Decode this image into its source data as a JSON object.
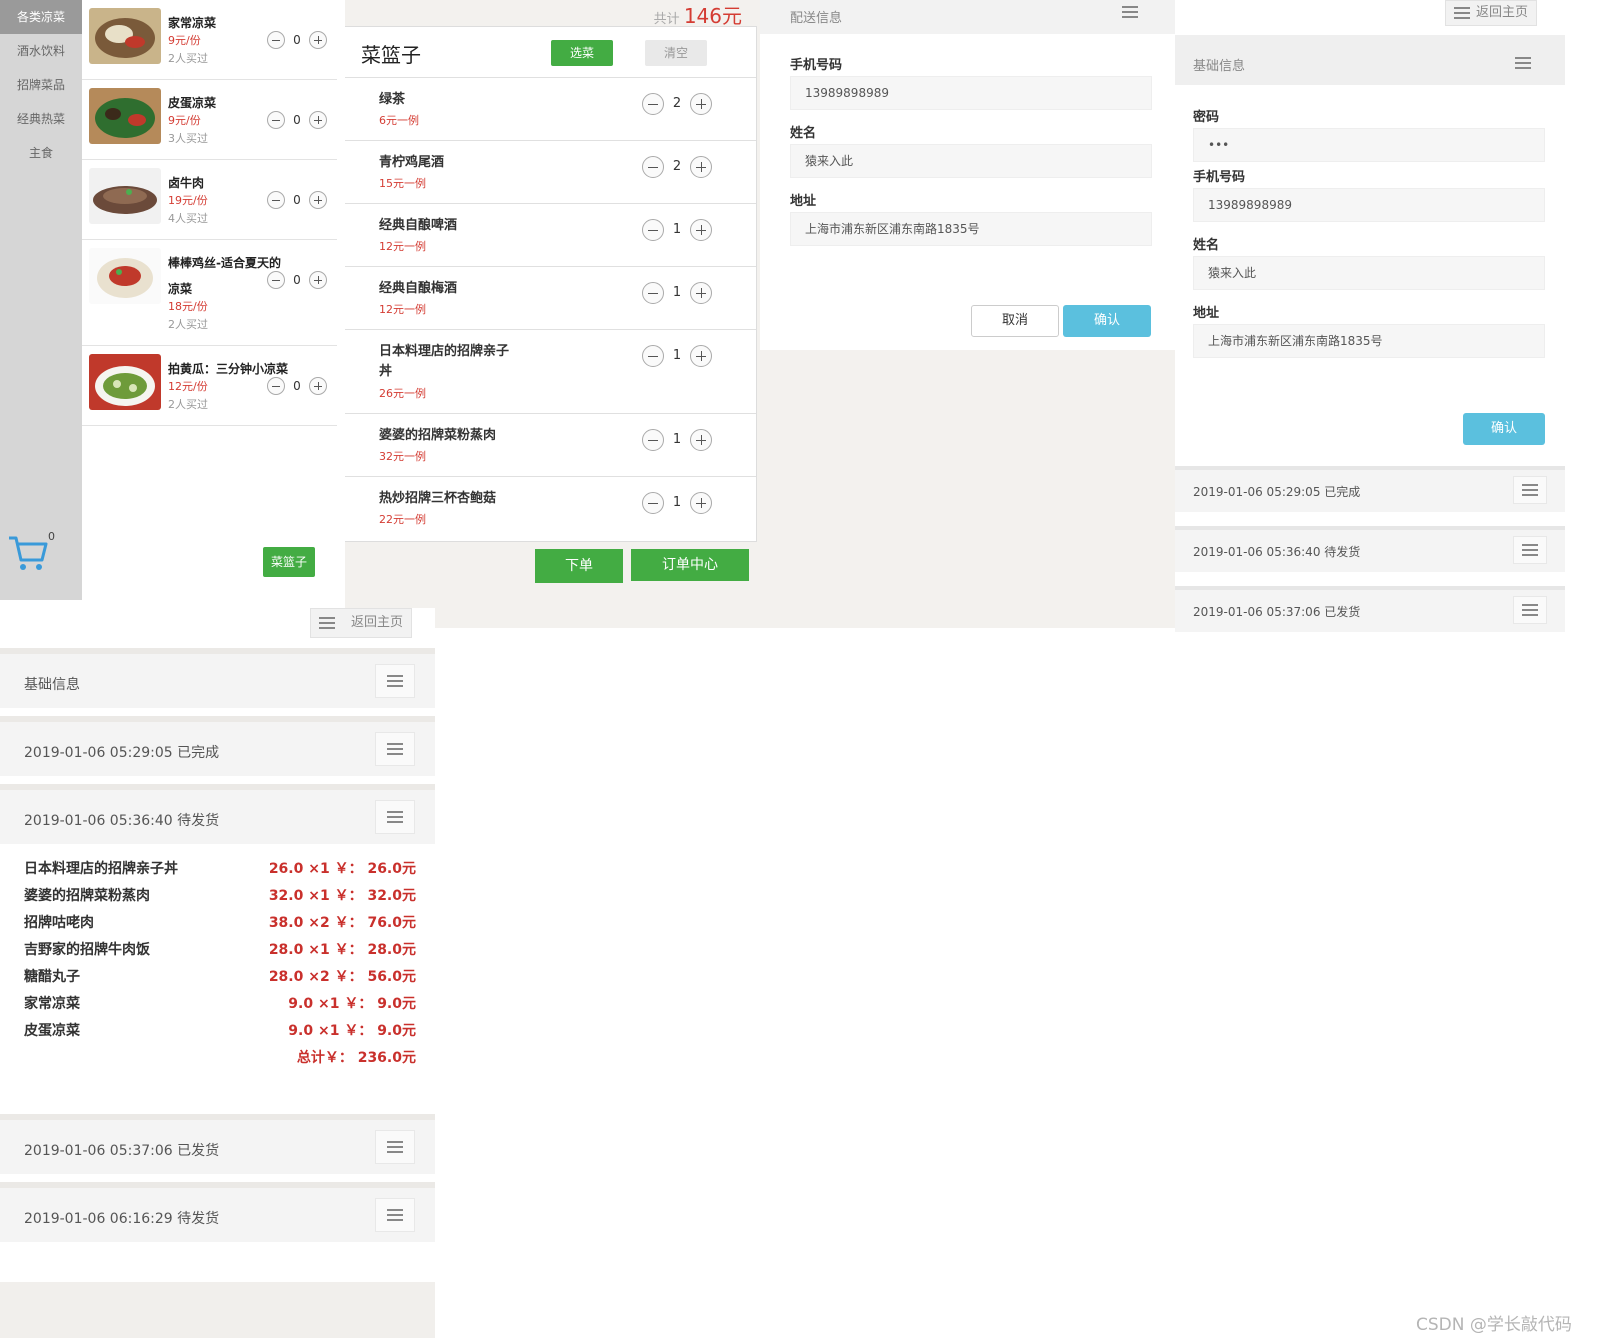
{
  "menu": {
    "categories": [
      "各类凉菜",
      "酒水饮料",
      "招牌菜品",
      "经典热菜",
      "主食"
    ],
    "cart_count": "0",
    "dishes": [
      {
        "name": "家常凉菜",
        "price": "9元/份",
        "sold": "2人买过",
        "qty": "0"
      },
      {
        "name": "皮蛋凉菜",
        "price": "9元/份",
        "sold": "3人买过",
        "qty": "0"
      },
      {
        "name": "卤牛肉",
        "price": "19元/份",
        "sold": "4人买过",
        "qty": "0"
      },
      {
        "name": "棒棒鸡丝-适合夏天的",
        "name2": "凉菜",
        "price": "18元/份",
        "sold": "2人买过",
        "qty": "0"
      },
      {
        "name": "拍黄瓜：三分钟小凉菜",
        "price": "12元/份",
        "sold": "2人买过",
        "qty": "0"
      }
    ],
    "basket_label": "菜篮子"
  },
  "basket": {
    "total_label": "共计",
    "total_value": "146元",
    "title": "菜篮子",
    "pick_label": "选菜",
    "clear_label": "清空",
    "items": [
      {
        "name": "绿茶",
        "price": "6元一例",
        "qty": "2"
      },
      {
        "name": "青柠鸡尾酒",
        "price": "15元一例",
        "qty": "2"
      },
      {
        "name": "经典自酿啤酒",
        "price": "12元一例",
        "qty": "1"
      },
      {
        "name": "经典自酿梅酒",
        "price": "12元一例",
        "qty": "1"
      },
      {
        "name": "日本料理店的招牌亲子丼",
        "price": "26元一例",
        "qty": "1"
      },
      {
        "name": "婆婆的招牌菜粉蒸肉",
        "price": "32元一例",
        "qty": "1"
      },
      {
        "name": "热炒招牌三杯杏鲍菇",
        "price": "22元一例",
        "qty": "1"
      }
    ],
    "order_label": "下单",
    "center_label": "订单中心"
  },
  "delivery": {
    "header": "配送信息",
    "phone_label": "手机号码",
    "phone_value": "13989898989",
    "name_label": "姓名",
    "name_value": "猿来入此",
    "address_label": "地址",
    "address_value": "上海市浦东新区浦东南路1835号",
    "cancel_label": "取消",
    "confirm_label": "确认"
  },
  "account": {
    "back_label": "返回主页",
    "info_header": "基础信息",
    "password_label": "密码",
    "password_value": "•••",
    "phone_label": "手机号码",
    "phone_value": "13989898989",
    "name_label": "姓名",
    "name_value": "猿来入此",
    "address_label": "地址",
    "address_value": "上海市浦东新区浦东南路1835号",
    "confirm_label": "确认",
    "orders": [
      "2019-01-06 05:29:05 已完成",
      "2019-01-06 05:36:40 待发货",
      "2019-01-06 05:37:06 已发货"
    ]
  },
  "orders_panel": {
    "back_label": "返回主页",
    "info_header": "基础信息",
    "order1": "2019-01-06 05:29:05 已完成",
    "order2": "2019-01-06 05:36:40 待发货",
    "details": [
      {
        "name": "日本料理店的招牌亲子丼",
        "calc": "26.0 ×1 ￥： 26.0元"
      },
      {
        "name": "婆婆的招牌菜粉蒸肉",
        "calc": "32.0 ×1 ￥： 32.0元"
      },
      {
        "name": "招牌咕咾肉",
        "calc": "38.0 ×2 ￥： 76.0元"
      },
      {
        "name": "吉野家的招牌牛肉饭",
        "calc": "28.0 ×1 ￥： 28.0元"
      },
      {
        "name": "糖醋丸子",
        "calc": "28.0 ×2 ￥： 56.0元"
      },
      {
        "name": "家常凉菜",
        "calc": "9.0 ×1 ￥： 9.0元"
      },
      {
        "name": "皮蛋凉菜",
        "calc": "9.0 ×1 ￥： 9.0元"
      }
    ],
    "total": "总计￥： 236.0元",
    "order3": "2019-01-06 05:37:06 已发货",
    "order4": "2019-01-06 06:16:29 待发货"
  },
  "watermark": "CSDN @学长敲代码",
  "colors": {
    "green": "#43ac43",
    "red": "#d43c33",
    "blue": "#5bc0de"
  }
}
